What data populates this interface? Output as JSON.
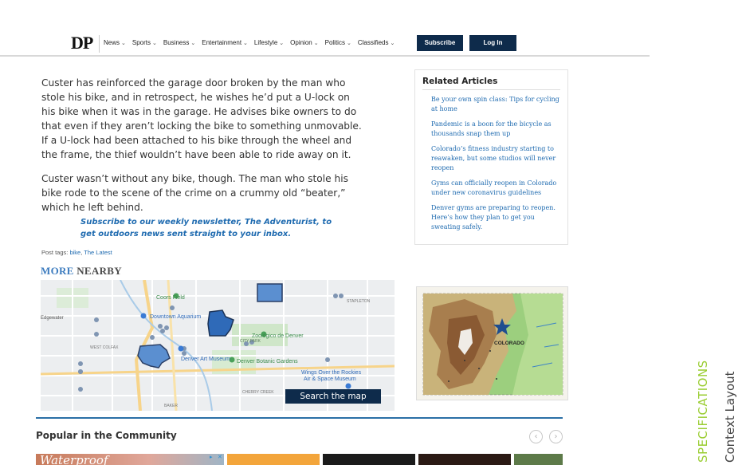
{
  "header": {
    "logo": "DP",
    "nav": [
      "News",
      "Sports",
      "Business",
      "Entertainment",
      "Lifestyle",
      "Opinion",
      "Politics",
      "Classifieds"
    ],
    "subscribe_label": "Subscribe",
    "login_label": "Log In"
  },
  "article": {
    "paragraphs": [
      "Custer has reinforced the garage door broken by the man who stole his bike, and in retrospect, he wishes he’d put a U-lock on his bike when it was in the garage. He advises bike owners to do that even if they aren’t locking the bike to something unmovable. If a U-lock had been attached to his bike through the wheel and the frame, the thief wouldn’t have been able to ride away on it.",
      "Custer wasn’t without any bike, though. The man who stole his bike rode to the scene of the crime on a crummy old “beater,” which he left behind."
    ],
    "newsletter": "Subscribe to our weekly newsletter, The Adventurist, to get outdoors news sent straight to your inbox.",
    "post_tags_label": "Post tags:",
    "tags": [
      "bike",
      "The Latest"
    ]
  },
  "related": {
    "title": "Related Articles",
    "items": [
      "Be your own spin class: Tips for cycling at home",
      "Pandemic is a boon for the bicycle as thousands snap them up",
      "Colorado’s fitness industry starting to reawaken, but some studios will never reopen",
      "Gyms can officially reopen in Colorado under new coronavirus guidelines",
      "Denver gyms are preparing to reopen. Here’s how they plan to get you sweating safely."
    ]
  },
  "nearby": {
    "heading_part1": "MORE",
    "heading_part2": "NEARBY",
    "map_labels": [
      "Coors Field",
      "Downtown Aquarium",
      "Zoológico de Denver",
      "CITY PARK",
      "Denver Art Museum",
      "Denver Botanic Gardens",
      "Wings Over the Rockies Air & Space Museum",
      "Edgewater",
      "STAPLETON",
      "WEST COLFAX",
      "CHERRY CREEK",
      "BAKER"
    ],
    "map_button": "Search the map",
    "co_map_label": "COLORADO"
  },
  "popular": {
    "title": "Popular in the Community",
    "prev": "‹",
    "next": "›",
    "ad_text": "Waterproof"
  },
  "side": {
    "specifications": "SPECIFICATIONS",
    "context_layout": "Context Layout"
  }
}
